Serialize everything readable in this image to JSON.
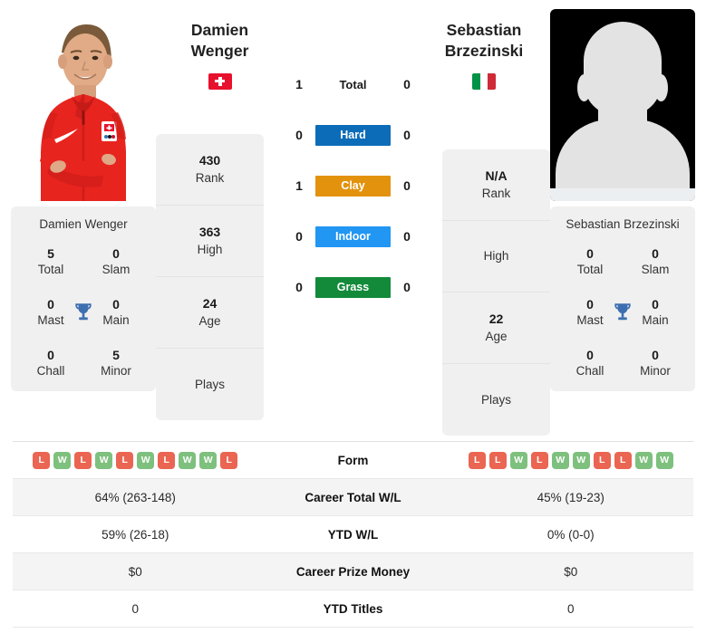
{
  "players": {
    "left": {
      "name_line1": "Damien",
      "name_line2": "Wenger",
      "full_name": "Damien Wenger",
      "flag": "swiss-flag",
      "country_code": "CH",
      "photo": "player-photo",
      "rank": "430",
      "rank_label": "Rank",
      "high": "363",
      "high_label": "High",
      "age": "24",
      "age_label": "Age",
      "plays_label": "Plays",
      "plays": "",
      "titles": {
        "total": "5",
        "total_label": "Total",
        "slam": "0",
        "slam_label": "Slam",
        "mast": "0",
        "mast_label": "Mast",
        "main": "0",
        "main_label": "Main",
        "chall": "0",
        "chall_label": "Chall",
        "minor": "5",
        "minor_label": "Minor"
      },
      "form": [
        "L",
        "W",
        "L",
        "W",
        "L",
        "W",
        "L",
        "W",
        "W",
        "L"
      ],
      "career_total_wl": "64% (263-148)",
      "ytd_wl": "59% (26-18)",
      "career_prize_money": "$0",
      "ytd_titles": "0"
    },
    "right": {
      "name_line1": "Sebastian",
      "name_line2": "Brzezinski",
      "full_name": "Sebastian Brzezinski",
      "flag": "italy-flag",
      "country_code": "IT",
      "photo": "player-photo-placeholder",
      "rank": "N/A",
      "rank_label": "Rank",
      "high": "",
      "high_label": "High",
      "age": "22",
      "age_label": "Age",
      "plays_label": "Plays",
      "plays": "",
      "titles": {
        "total": "0",
        "total_label": "Total",
        "slam": "0",
        "slam_label": "Slam",
        "mast": "0",
        "mast_label": "Mast",
        "main": "0",
        "main_label": "Main",
        "chall": "0",
        "chall_label": "Chall",
        "minor": "0",
        "minor_label": "Minor"
      },
      "form": [
        "L",
        "L",
        "W",
        "L",
        "W",
        "W",
        "L",
        "L",
        "W",
        "W"
      ],
      "career_total_wl": "45% (19-23)",
      "ytd_wl": "0% (0-0)",
      "career_prize_money": "$0",
      "ytd_titles": "0"
    }
  },
  "surfaces": [
    {
      "label": "Total",
      "left": "1",
      "right": "0",
      "color": "#ffffff",
      "plain": true
    },
    {
      "label": "Hard",
      "left": "0",
      "right": "0",
      "color": "#0c6cb8",
      "plain": false
    },
    {
      "label": "Clay",
      "left": "1",
      "right": "0",
      "color": "#e3920d",
      "plain": false
    },
    {
      "label": "Indoor",
      "left": "0",
      "right": "0",
      "color": "#2196f3",
      "plain": false
    },
    {
      "label": "Grass",
      "left": "0",
      "right": "0",
      "color": "#128a3a",
      "plain": false
    }
  ],
  "comparison_rows": [
    {
      "label": "Form",
      "left": "",
      "right": "",
      "type": "form"
    },
    {
      "label": "Career Total W/L",
      "left": "64% (263-148)",
      "right": "45% (19-23)",
      "type": "text"
    },
    {
      "label": "YTD W/L",
      "left": "59% (26-18)",
      "right": "0% (0-0)",
      "type": "text"
    },
    {
      "label": "Career Prize Money",
      "left": "$0",
      "right": "$0",
      "type": "text"
    },
    {
      "label": "YTD Titles",
      "left": "0",
      "right": "0",
      "type": "text"
    }
  ],
  "colors": {
    "hard": "#0c6cb8",
    "clay": "#e3920d",
    "indoor": "#2196f3",
    "grass": "#128a3a",
    "win_badge": "#7ec07e",
    "loss_badge": "#ea6552",
    "trophy": "#3d6fb0",
    "card_bg": "#f0f0f0"
  }
}
